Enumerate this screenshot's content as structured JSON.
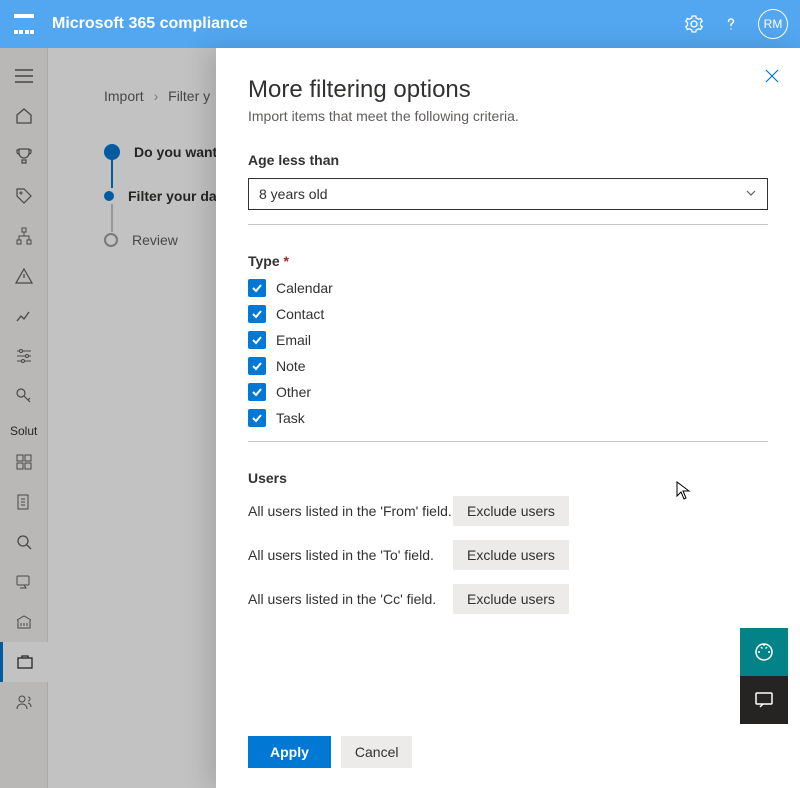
{
  "header": {
    "app_title": "Microsoft 365 compliance",
    "avatar_initials": "RM"
  },
  "sidebar": {
    "solutions_label": "Solut"
  },
  "breadcrumb": {
    "item1": "Import",
    "item2": "Filter y"
  },
  "steps": {
    "step1": "Do you want",
    "step2": "Filter your data",
    "step3": "Review"
  },
  "panel": {
    "title": "More filtering options",
    "subtitle": "Import items that meet the following criteria.",
    "age_label": "Age less than",
    "age_value": "8 years old",
    "type_label": "Type",
    "type_options": {
      "calendar": "Calendar",
      "contact": "Contact",
      "email": "Email",
      "note": "Note",
      "other": "Other",
      "task": "Task"
    },
    "users_label": "Users",
    "users_from": "All users listed in the 'From' field.",
    "users_to": "All users listed in the 'To' field.",
    "users_cc": "All users listed in the 'Cc' field.",
    "exclude_btn": "Exclude users",
    "apply": "Apply",
    "cancel": "Cancel"
  }
}
